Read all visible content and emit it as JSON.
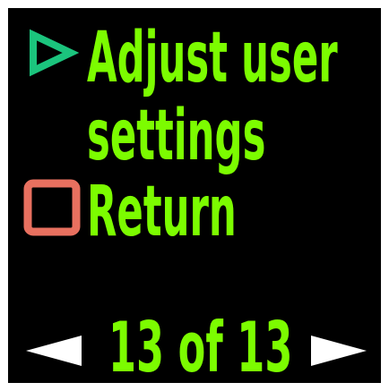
{
  "menu": {
    "primary_action": {
      "icon": "triangle-play-icon",
      "icon_color": "#1BC47D",
      "label_line_1": "Adjust user",
      "label_line_2": "settings"
    },
    "secondary_action": {
      "icon": "square-stop-icon",
      "icon_color": "#E8705F",
      "label": "Return"
    }
  },
  "pagination": {
    "label": "13 of 13",
    "prev_icon": "left-arrow-icon",
    "next_icon": "right-arrow-icon",
    "arrow_color": "#FFFFFF"
  },
  "theme": {
    "text_color": "#7CFC00",
    "background": "#000000"
  }
}
